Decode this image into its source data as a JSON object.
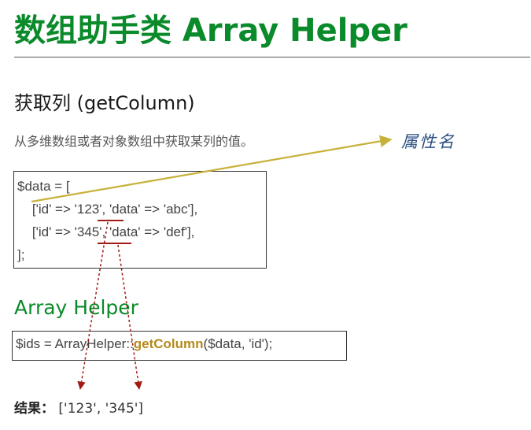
{
  "header": {
    "title": "数组助手类 Array Helper"
  },
  "section": {
    "heading": "获取列 (getColumn)",
    "description": "从多维数组或者对象数组中获取某列的值。"
  },
  "annotation": {
    "label": "属性名"
  },
  "code_example": {
    "lines": [
      "$data = [",
      "    ['id' => '123', 'data' => 'abc'],",
      "    ['id' => '345', 'data' => 'def'],",
      "];"
    ]
  },
  "helper": {
    "heading": "Array Helper",
    "call_prefix": "$ids = ArrayHelper::",
    "call_fn": "getColumn",
    "call_suffix": "($data, 'id');"
  },
  "result": {
    "label": "结果：",
    "value": "['123', '345']"
  },
  "colors": {
    "green": "#0a8a2a",
    "arrow_gold": "#c8b13a",
    "arrow_red": "#a31a12",
    "annotation_blue": "#2a4f80"
  }
}
